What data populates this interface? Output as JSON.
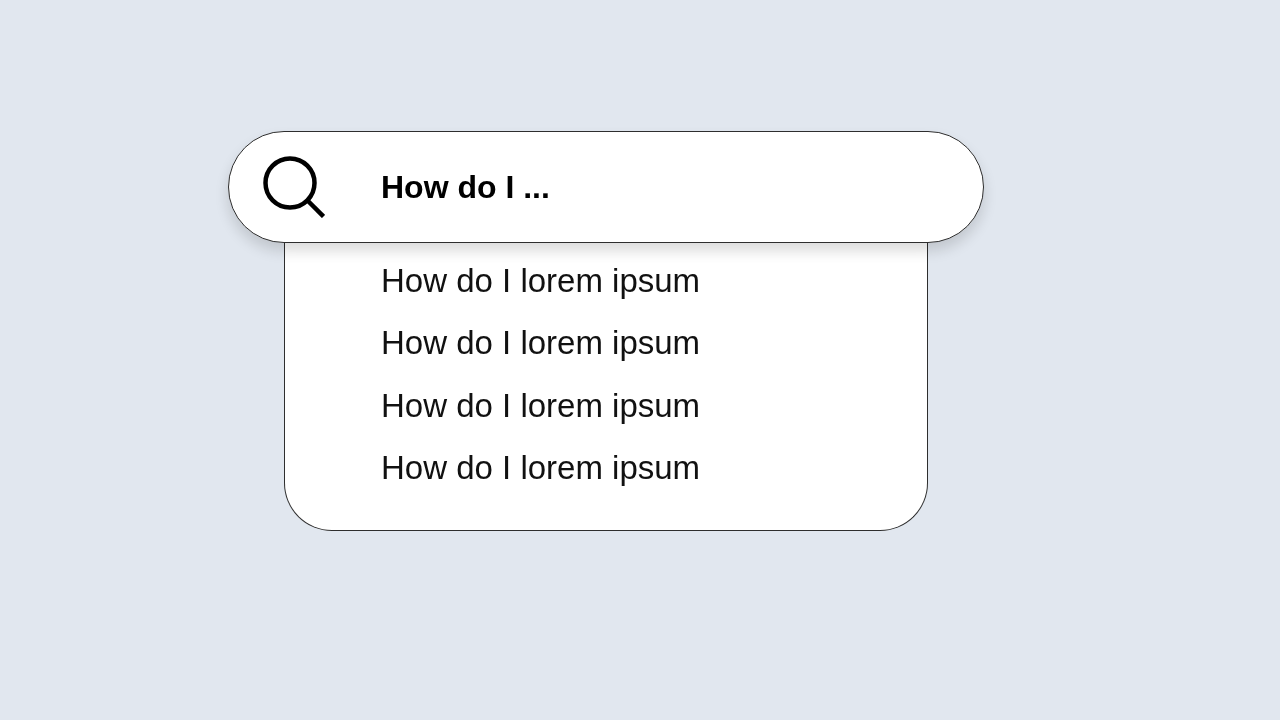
{
  "search": {
    "value": "How do I ..."
  },
  "suggestions": [
    {
      "label": "How do I lorem ipsum"
    },
    {
      "label": "How do I lorem ipsum"
    },
    {
      "label": "How do I lorem ipsum"
    },
    {
      "label": "How do I lorem ipsum"
    }
  ]
}
